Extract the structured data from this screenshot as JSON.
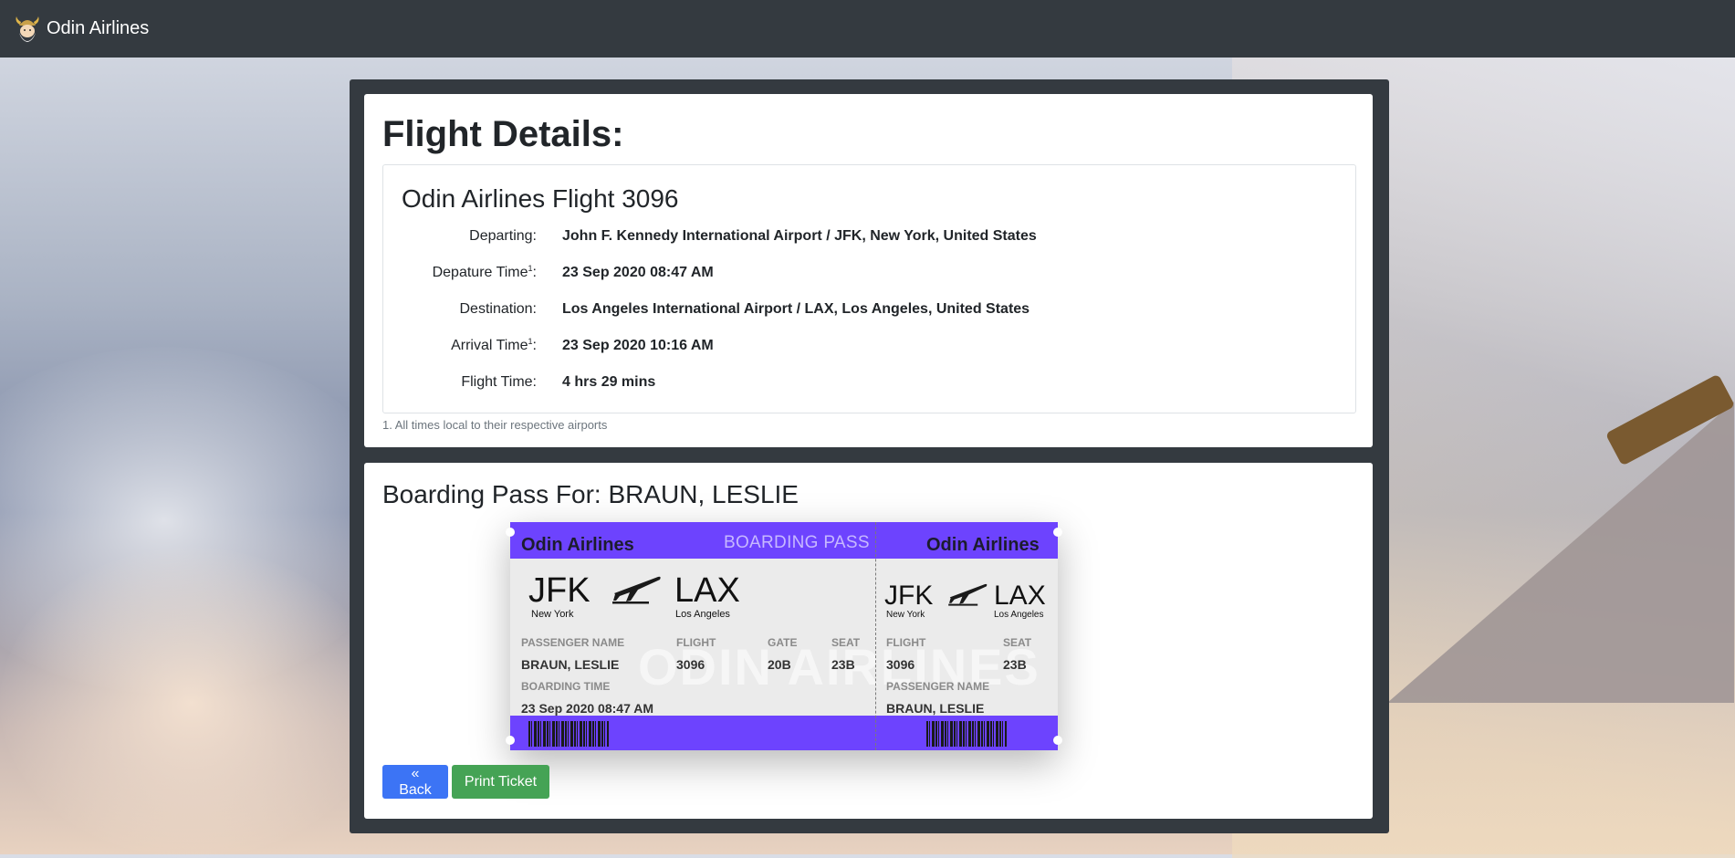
{
  "navbar": {
    "brand": "Odin Airlines",
    "logo_icon": "viking-helmet-icon"
  },
  "details": {
    "heading": "Flight Details:",
    "flight_title": "Odin Airlines Flight 3096",
    "rows": [
      {
        "label": "Departing:",
        "value": "John F. Kennedy International Airport / JFK, New York, United States"
      },
      {
        "label": "Depature Time",
        "sup": "1",
        "suffix": ":",
        "value": "23 Sep 2020 08:47 AM"
      },
      {
        "label": "Destination:",
        "value": "Los Angeles International Airport / LAX, Los Angeles, United States"
      },
      {
        "label": "Arrival Time",
        "sup": "1",
        "suffix": ":",
        "value": "23 Sep 2020 10:16 AM"
      },
      {
        "label": "Flight Time:",
        "value": "4 hrs 29 mins"
      }
    ],
    "footnote": "1. All times local to their respective airports"
  },
  "boarding": {
    "heading": "Boarding Pass For: BRAUN, LESLIE",
    "ticket": {
      "airline": "Odin Airlines",
      "title": "BOARDING PASS",
      "from_code": "JFK",
      "from_city": "New York",
      "to_code": "LAX",
      "to_city": "Los Angeles",
      "watermark": "ODIN AIRLINES",
      "labels": {
        "passenger": "PASSENGER NAME",
        "flight": "FLIGHT",
        "gate": "GATE",
        "seat": "SEAT",
        "boarding_time": "BOARDING TIME"
      },
      "passenger": "BRAUN, LESLIE",
      "flight": "3096",
      "gate": "20B",
      "seat": "23B",
      "boarding_time": "23 Sep 2020 08:47 AM"
    },
    "back_button": "« Back",
    "print_button": "Print Ticket"
  },
  "colors": {
    "navbar": "#343a40",
    "ticket_accent": "#6d43fe",
    "back_button": "#3c74f5",
    "print_button": "#45a355"
  }
}
